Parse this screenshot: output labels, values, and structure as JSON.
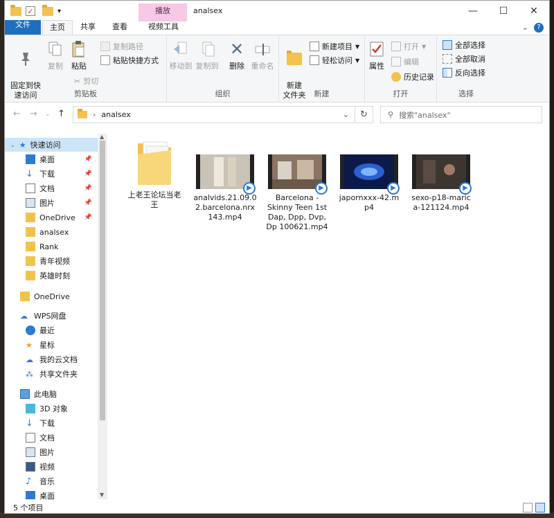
{
  "window": {
    "title": "analsex",
    "context_tab": "播放"
  },
  "tabs": [
    "文件",
    "主页",
    "共享",
    "查看",
    "视频工具"
  ],
  "ribbon": {
    "clipboard": {
      "pin": "固定到快\n速访问",
      "copy": "复制",
      "paste": "粘贴",
      "copy_path": "复制路径",
      "paste_shortcut": "粘贴快捷方式",
      "cut": "剪切",
      "label": "剪贴板"
    },
    "organize": {
      "move_to": "移动到",
      "copy_to": "复制到",
      "delete": "删除",
      "rename": "重命名",
      "label": "组织"
    },
    "new": {
      "new_folder": "新建\n文件夹",
      "new_item": "新建项目",
      "easy_access": "轻松访问",
      "label": "新建"
    },
    "open": {
      "properties": "属性",
      "open": "打开",
      "edit": "编辑",
      "history": "历史记录",
      "label": "打开"
    },
    "select": {
      "select_all": "全部选择",
      "select_none": "全部取消",
      "invert": "反向选择",
      "label": "选择"
    }
  },
  "address": {
    "path": "analsex",
    "search_placeholder": "搜索\"analsex\""
  },
  "nav": {
    "quick_access": "快速访问",
    "items_quick": [
      "桌面",
      "下载",
      "文档",
      "图片",
      "OneDrive",
      "analsex",
      "Rank",
      "青年视频",
      "英雄时刻"
    ],
    "onedrive": "OneDrive",
    "wps": "WPS网盘",
    "items_wps": [
      "最近",
      "星标",
      "我的云文档",
      "共享文件夹"
    ],
    "pc": "此电脑",
    "items_pc": [
      "3D 对象",
      "下载",
      "文档",
      "图片",
      "视频",
      "音乐",
      "桌面"
    ]
  },
  "files": [
    {
      "name": "上老王论坛当老\n王",
      "kind": "folder"
    },
    {
      "name": "analvids.21.09.0\n2.barcelona.nrx\n143.mp4",
      "kind": "video",
      "color": "#b9b3a8"
    },
    {
      "name": "Barcelona -\nSkinny Teen 1st\nDap, Dpp, Dvp,\nDp 100621.mp4",
      "kind": "video",
      "color": "#7a6a5e"
    },
    {
      "name": "japornxxx-42.m\np4",
      "kind": "video",
      "color": "#1a3f9a"
    },
    {
      "name": "sexo-p18-maric\na-121124.mp4",
      "kind": "video",
      "color": "#3d3530"
    }
  ],
  "status": {
    "count": "5 个项目"
  }
}
